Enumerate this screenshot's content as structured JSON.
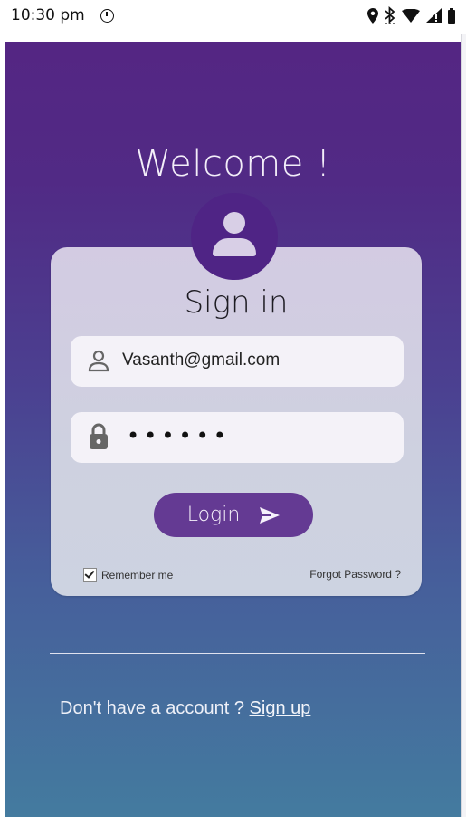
{
  "status_bar": {
    "time": "10:30 pm",
    "icons": [
      "alarm-icon",
      "location-icon",
      "bluetooth-icon",
      "wifi-icon",
      "signal-icon",
      "battery-icon"
    ]
  },
  "screen": {
    "welcome_title": "Welcome !",
    "card": {
      "title": "Sign in",
      "email_value": "Vasanth@gmail.com",
      "password_mask": "••••••",
      "login_label": "Login",
      "remember_label": "Remember me",
      "remember_checked": true,
      "forgot_label": "Forgot Password ?"
    },
    "signup_prompt": "Don't have a account ?",
    "signup_link": "Sign up"
  },
  "colors": {
    "gradient_top": "#542683",
    "gradient_bottom": "#447b9f",
    "avatar_bg": "#4f2485",
    "login_button": "#643a93",
    "card_bg": "#d3cbe2"
  }
}
